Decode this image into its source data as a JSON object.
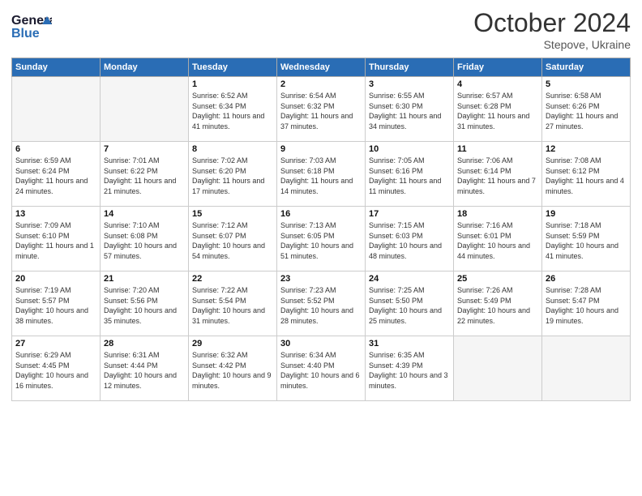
{
  "header": {
    "logo_line1": "General",
    "logo_line2": "Blue",
    "month": "October 2024",
    "location": "Stepove, Ukraine"
  },
  "weekdays": [
    "Sunday",
    "Monday",
    "Tuesday",
    "Wednesday",
    "Thursday",
    "Friday",
    "Saturday"
  ],
  "weeks": [
    [
      {
        "day": "",
        "info": ""
      },
      {
        "day": "",
        "info": ""
      },
      {
        "day": "1",
        "info": "Sunrise: 6:52 AM\nSunset: 6:34 PM\nDaylight: 11 hours and 41 minutes."
      },
      {
        "day": "2",
        "info": "Sunrise: 6:54 AM\nSunset: 6:32 PM\nDaylight: 11 hours and 37 minutes."
      },
      {
        "day": "3",
        "info": "Sunrise: 6:55 AM\nSunset: 6:30 PM\nDaylight: 11 hours and 34 minutes."
      },
      {
        "day": "4",
        "info": "Sunrise: 6:57 AM\nSunset: 6:28 PM\nDaylight: 11 hours and 31 minutes."
      },
      {
        "day": "5",
        "info": "Sunrise: 6:58 AM\nSunset: 6:26 PM\nDaylight: 11 hours and 27 minutes."
      }
    ],
    [
      {
        "day": "6",
        "info": "Sunrise: 6:59 AM\nSunset: 6:24 PM\nDaylight: 11 hours and 24 minutes."
      },
      {
        "day": "7",
        "info": "Sunrise: 7:01 AM\nSunset: 6:22 PM\nDaylight: 11 hours and 21 minutes."
      },
      {
        "day": "8",
        "info": "Sunrise: 7:02 AM\nSunset: 6:20 PM\nDaylight: 11 hours and 17 minutes."
      },
      {
        "day": "9",
        "info": "Sunrise: 7:03 AM\nSunset: 6:18 PM\nDaylight: 11 hours and 14 minutes."
      },
      {
        "day": "10",
        "info": "Sunrise: 7:05 AM\nSunset: 6:16 PM\nDaylight: 11 hours and 11 minutes."
      },
      {
        "day": "11",
        "info": "Sunrise: 7:06 AM\nSunset: 6:14 PM\nDaylight: 11 hours and 7 minutes."
      },
      {
        "day": "12",
        "info": "Sunrise: 7:08 AM\nSunset: 6:12 PM\nDaylight: 11 hours and 4 minutes."
      }
    ],
    [
      {
        "day": "13",
        "info": "Sunrise: 7:09 AM\nSunset: 6:10 PM\nDaylight: 11 hours and 1 minute."
      },
      {
        "day": "14",
        "info": "Sunrise: 7:10 AM\nSunset: 6:08 PM\nDaylight: 10 hours and 57 minutes."
      },
      {
        "day": "15",
        "info": "Sunrise: 7:12 AM\nSunset: 6:07 PM\nDaylight: 10 hours and 54 minutes."
      },
      {
        "day": "16",
        "info": "Sunrise: 7:13 AM\nSunset: 6:05 PM\nDaylight: 10 hours and 51 minutes."
      },
      {
        "day": "17",
        "info": "Sunrise: 7:15 AM\nSunset: 6:03 PM\nDaylight: 10 hours and 48 minutes."
      },
      {
        "day": "18",
        "info": "Sunrise: 7:16 AM\nSunset: 6:01 PM\nDaylight: 10 hours and 44 minutes."
      },
      {
        "day": "19",
        "info": "Sunrise: 7:18 AM\nSunset: 5:59 PM\nDaylight: 10 hours and 41 minutes."
      }
    ],
    [
      {
        "day": "20",
        "info": "Sunrise: 7:19 AM\nSunset: 5:57 PM\nDaylight: 10 hours and 38 minutes."
      },
      {
        "day": "21",
        "info": "Sunrise: 7:20 AM\nSunset: 5:56 PM\nDaylight: 10 hours and 35 minutes."
      },
      {
        "day": "22",
        "info": "Sunrise: 7:22 AM\nSunset: 5:54 PM\nDaylight: 10 hours and 31 minutes."
      },
      {
        "day": "23",
        "info": "Sunrise: 7:23 AM\nSunset: 5:52 PM\nDaylight: 10 hours and 28 minutes."
      },
      {
        "day": "24",
        "info": "Sunrise: 7:25 AM\nSunset: 5:50 PM\nDaylight: 10 hours and 25 minutes."
      },
      {
        "day": "25",
        "info": "Sunrise: 7:26 AM\nSunset: 5:49 PM\nDaylight: 10 hours and 22 minutes."
      },
      {
        "day": "26",
        "info": "Sunrise: 7:28 AM\nSunset: 5:47 PM\nDaylight: 10 hours and 19 minutes."
      }
    ],
    [
      {
        "day": "27",
        "info": "Sunrise: 6:29 AM\nSunset: 4:45 PM\nDaylight: 10 hours and 16 minutes."
      },
      {
        "day": "28",
        "info": "Sunrise: 6:31 AM\nSunset: 4:44 PM\nDaylight: 10 hours and 12 minutes."
      },
      {
        "day": "29",
        "info": "Sunrise: 6:32 AM\nSunset: 4:42 PM\nDaylight: 10 hours and 9 minutes."
      },
      {
        "day": "30",
        "info": "Sunrise: 6:34 AM\nSunset: 4:40 PM\nDaylight: 10 hours and 6 minutes."
      },
      {
        "day": "31",
        "info": "Sunrise: 6:35 AM\nSunset: 4:39 PM\nDaylight: 10 hours and 3 minutes."
      },
      {
        "day": "",
        "info": ""
      },
      {
        "day": "",
        "info": ""
      }
    ]
  ]
}
